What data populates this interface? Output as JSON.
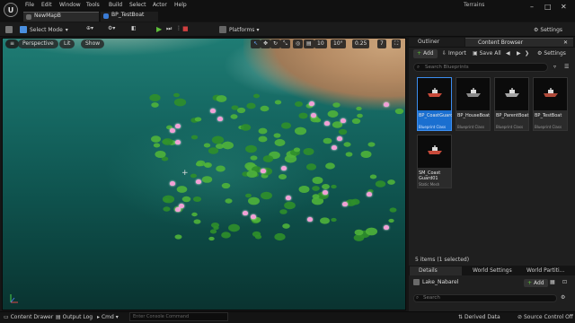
{
  "menu": [
    "File",
    "Edit",
    "Window",
    "Tools",
    "Build",
    "Select",
    "Actor",
    "Help"
  ],
  "tabs": [
    {
      "label": "NewMapB",
      "color": "#6b6b6b"
    },
    {
      "label": "BP_TestBoat",
      "color": "#3a7bd5"
    }
  ],
  "project": "Terrains",
  "toolbar": {
    "select_mode": "Select Mode",
    "platforms": "Platforms",
    "settings": "Settings"
  },
  "viewport": {
    "perspective": "Perspective",
    "lit": "Lit",
    "show": "Show",
    "grid_snap": "10",
    "rot_snap": "10°",
    "scale_snap": "0.25",
    "cam_speed": "7"
  },
  "outliner": {
    "tab": "Outliner"
  },
  "content_browser": {
    "tab": "Content Browser",
    "add": "Add",
    "import": "Import",
    "save_all": "Save All",
    "settings": "Settings",
    "search_placeholder": "Search Blueprints",
    "assets": [
      {
        "name": "BP_CoastGuard",
        "type": "Blueprint Class",
        "selected": true,
        "color": "#c84a3a"
      },
      {
        "name": "BP_HouseBoat",
        "type": "Blueprint Class",
        "selected": false,
        "color": "#8a8a8a"
      },
      {
        "name": "BP_ParentBoat",
        "type": "Blueprint Class",
        "selected": false,
        "color": "#a3a3a3"
      },
      {
        "name": "BP_TestBoat",
        "type": "Blueprint Class",
        "selected": false,
        "color": "#b04a3a"
      },
      {
        "name": "SM_Coast Guard01",
        "type": "Static Mesh",
        "selected": false,
        "color": "#c84a3a"
      }
    ],
    "status": "5 items (1 selected)"
  },
  "details": {
    "tabs": [
      "Details",
      "World Settings",
      "World Partiti..."
    ],
    "actor": "Lake_Nabarel",
    "add": "Add",
    "search_placeholder": "Search"
  },
  "statusbar": {
    "content_drawer": "Content Drawer",
    "output_log": "Output Log",
    "cmd": "Cmd",
    "console_placeholder": "Enter Console Command",
    "derived_data": "Derived Data",
    "source_control": "Source Control Off"
  },
  "colors": {
    "accent": "#1a6fd0",
    "play": "#5fbf3a"
  }
}
